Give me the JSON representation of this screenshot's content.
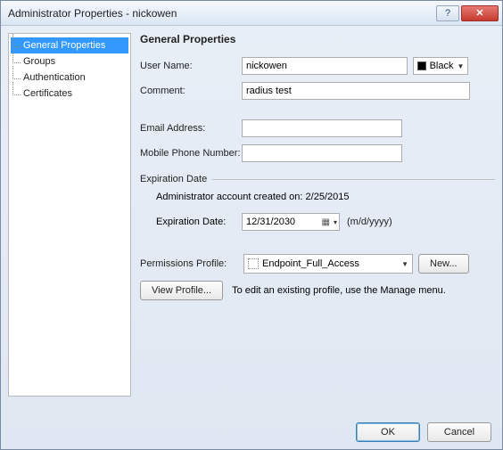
{
  "window": {
    "title": "Administrator Properties - nickowen"
  },
  "nav": {
    "items": [
      {
        "label": "General Properties",
        "selected": true
      },
      {
        "label": "Groups",
        "selected": false
      },
      {
        "label": "Authentication",
        "selected": false
      },
      {
        "label": "Certificates",
        "selected": false
      }
    ]
  },
  "heading": "General Properties",
  "fields": {
    "username_label": "User Name:",
    "username_value": "nickowen",
    "color_label": "Black",
    "comment_label": "Comment:",
    "comment_value": "radius test",
    "email_label": "Email Address:",
    "email_value": "",
    "mobile_label": "Mobile Phone Number:",
    "mobile_value": ""
  },
  "expiration": {
    "legend": "Expiration Date",
    "created_text": "Administrator account created on: 2/25/2015",
    "date_label": "Expiration Date:",
    "date_value": "12/31/2030",
    "format_hint": "(m/d/yyyy)"
  },
  "permissions": {
    "label": "Permissions Profile:",
    "selected": "Endpoint_Full_Access",
    "new_button": "New...",
    "view_button": "View Profile...",
    "edit_hint": "To edit an existing profile, use the Manage menu."
  },
  "footer": {
    "ok": "OK",
    "cancel": "Cancel"
  }
}
